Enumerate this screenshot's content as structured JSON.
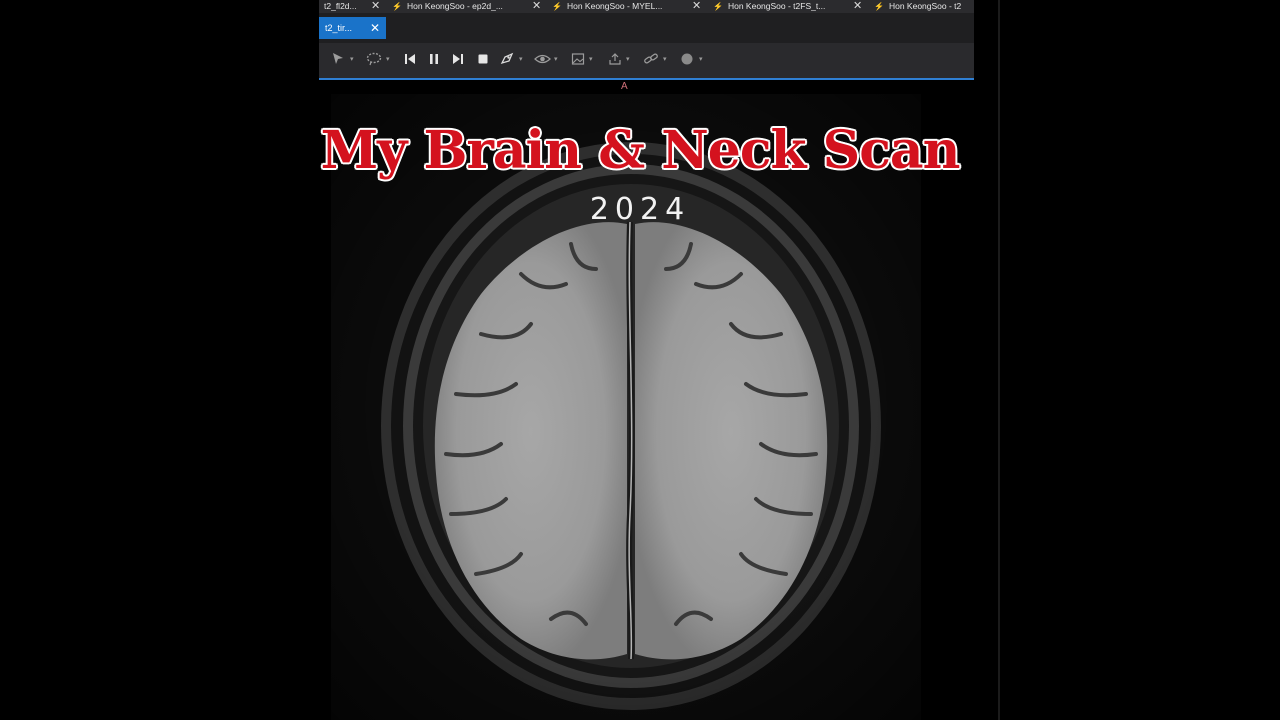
{
  "tabs": [
    {
      "label": "t2_fl2d..."
    },
    {
      "label": "Hon KeongSoo - ep2d_..."
    },
    {
      "label": "Hon KeongSoo - MYEL..."
    },
    {
      "label": "Hon KeongSoo - t2FS_t..."
    },
    {
      "label": "Hon KeongSoo - t2"
    }
  ],
  "active_subtab": {
    "label": "t2_tir..."
  },
  "toolbar": {
    "tools": [
      "pointer-icon",
      "lasso-icon",
      "skip-back-icon",
      "pause-icon",
      "skip-forward-icon",
      "stop-icon",
      "rocket-icon",
      "eye-icon",
      "image-icon",
      "share-icon",
      "link-icon",
      "circle-icon"
    ]
  },
  "viewer": {
    "orientation_marker": "A"
  },
  "overlay": {
    "title": "My Brain & Neck Scan",
    "subtitle": "2024"
  },
  "colors": {
    "accent_blue": "#1a73c9",
    "title_red": "#d4121e"
  }
}
